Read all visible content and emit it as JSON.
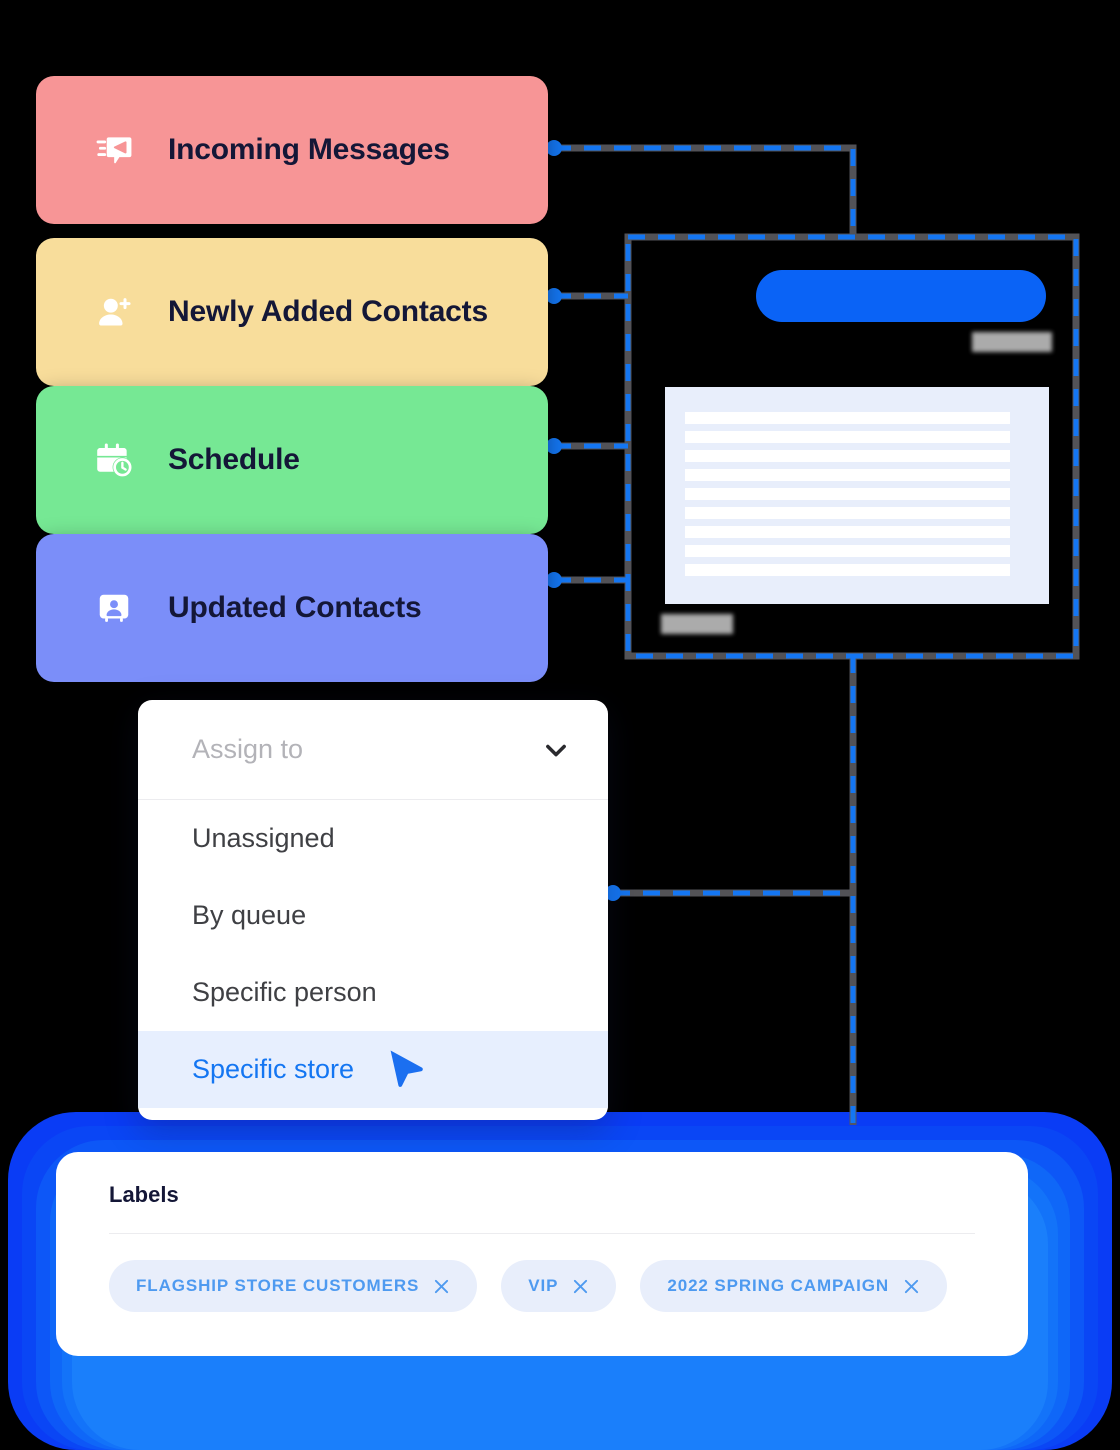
{
  "theme": {
    "background": "#000000",
    "accent_blue": "#0A63F6",
    "connector_blue": "#1476F2",
    "connector_shadow": "#555555",
    "chip_bg": "#E8EEFB",
    "chip_text": "#4E9AF0",
    "dark_text": "#141737"
  },
  "trigger_cards": [
    {
      "label": "Incoming Messages",
      "icon": "message-send-icon",
      "color": "#F79596",
      "node_dot": true
    },
    {
      "label": "Newly Added Contacts",
      "icon": "user-plus-icon",
      "color": "#F8DD9B",
      "node_dot": true
    },
    {
      "label": "Schedule",
      "icon": "calendar-clock-icon",
      "color": "#76E894",
      "node_dot": true
    },
    {
      "label": "Updated Contacts",
      "icon": "contact-card-icon",
      "color": "#7B8EF9",
      "node_dot": true
    }
  ],
  "preview_panel": {
    "name": "message-preview-panel",
    "border_style": "dashed",
    "border_color": "#1476F2",
    "blue_button": {
      "name": "preview-primary-button",
      "color": "#0A63F6"
    },
    "blurred_text_blocks": 2,
    "skeleton_rows": 9
  },
  "assign_dropdown": {
    "placeholder": "Assign to",
    "chevron_icon": "chevron-down-icon",
    "options": [
      {
        "label": "Unassigned",
        "selected": false
      },
      {
        "label": "By queue",
        "selected": false
      },
      {
        "label": "Specific person",
        "selected": false
      },
      {
        "label": "Specific store",
        "selected": true
      }
    ],
    "cursor_icon": "mouse-pointer-icon"
  },
  "labels_panel": {
    "title": "Labels",
    "chips": [
      {
        "text": "FLAGSHIP STORE CUSTOMERS",
        "remove_icon": "close-icon"
      },
      {
        "text": "VIP",
        "remove_icon": "close-icon"
      },
      {
        "text": "2022 SPRING CAMPAIGN",
        "remove_icon": "close-icon"
      }
    ],
    "glow_rings": [
      "#0A3CF5",
      "#0A3CF5",
      "#0A52F6",
      "#0E63F8",
      "#1271F9",
      "#1A7BFA"
    ]
  }
}
